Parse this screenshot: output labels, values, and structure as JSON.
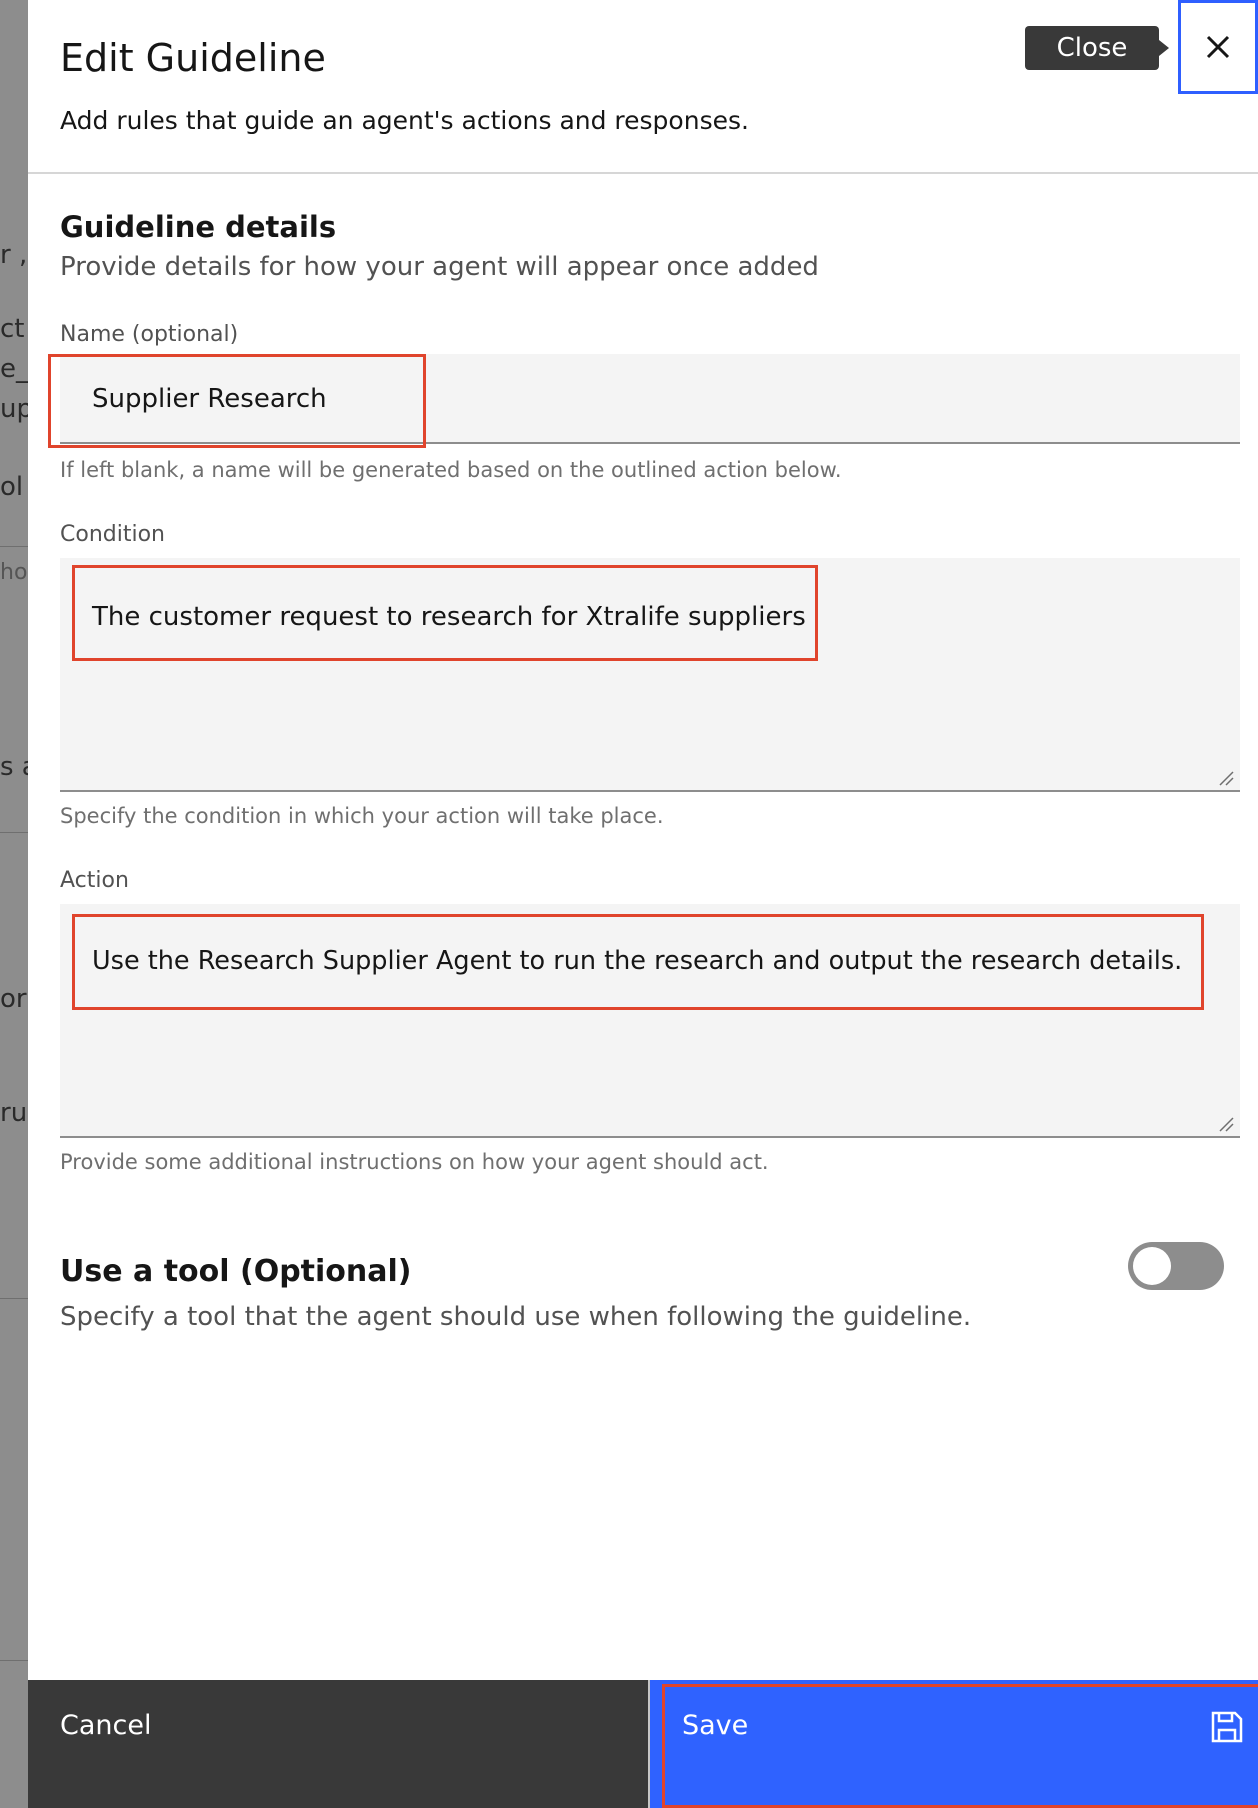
{
  "background": {
    "fragments": [
      "r ,",
      "ct n",
      "e_b",
      "up",
      "ol",
      "ho",
      "s a",
      "or .",
      "ru"
    ]
  },
  "panel": {
    "title": "Edit Guideline",
    "subtitle": "Add rules that guide an agent's actions and responses.",
    "close_tooltip": "Close"
  },
  "details": {
    "title": "Guideline details",
    "subtitle": "Provide details for how your agent will appear once added"
  },
  "name_field": {
    "label": "Name (optional)",
    "value": "Supplier Research",
    "helper": "If left blank, a name will be generated based on the outlined action below."
  },
  "condition_field": {
    "label": "Condition",
    "value": "The customer request to research for Xtralife suppliers",
    "helper": "Specify the condition in which your action will take place."
  },
  "action_field": {
    "label": "Action",
    "value": "Use the Research Supplier Agent to run the research and output the research details.",
    "helper": "Provide some additional instructions on how your agent should act."
  },
  "tool": {
    "title": "Use a tool (Optional)",
    "subtitle": "Specify a tool that the agent should use when following the guideline.",
    "enabled": false
  },
  "footer": {
    "cancel_label": "Cancel",
    "save_label": "Save"
  },
  "colors": {
    "primary": "#2f62ff",
    "highlight": "#e0442c",
    "focus": "#2f5fff"
  }
}
